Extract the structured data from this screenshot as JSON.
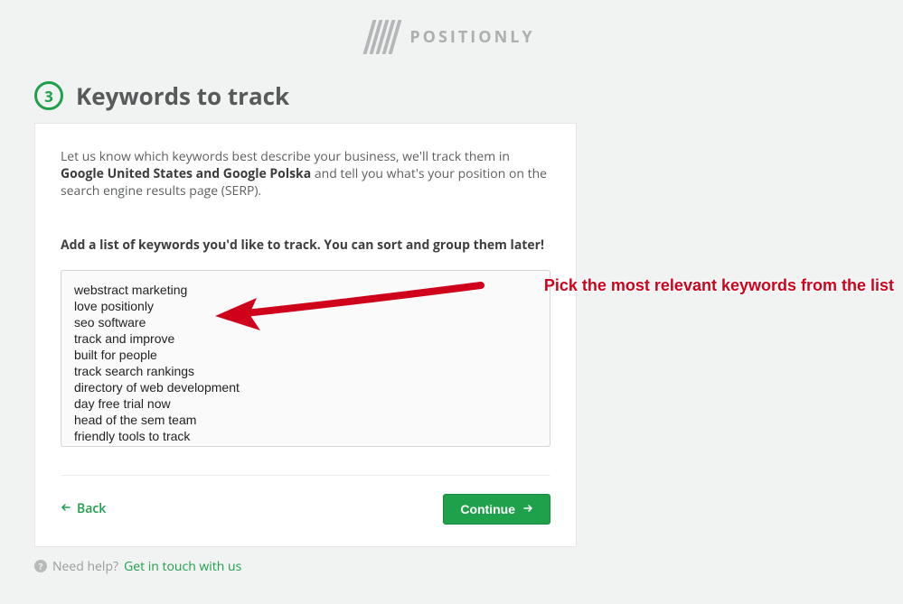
{
  "logo": {
    "name": "POSITIONLY"
  },
  "step": {
    "number": "3",
    "title": "Keywords to track"
  },
  "description": {
    "prefix": "Let us know which keywords best describe your business, we'll track them in ",
    "bold": "Google United States and Google Polska",
    "suffix": " and tell you what's your position on the search engine results page (SERP)."
  },
  "subhead": "Add a list of keywords you'd like to track. You can sort and group them later!",
  "keywords_text": "webstract marketing\nlove positionly\nseo software\ntrack and improve\nbuilt for people\ntrack search rankings\ndirectory of web development\nday free trial now\nhead of the sem team\nfriendly tools to track",
  "back_label": "Back",
  "continue_label": "Continue",
  "help": {
    "prefix": "Need help? ",
    "link": "Get in touch with us"
  },
  "callout": "Pick the most relevant keywords from the list"
}
